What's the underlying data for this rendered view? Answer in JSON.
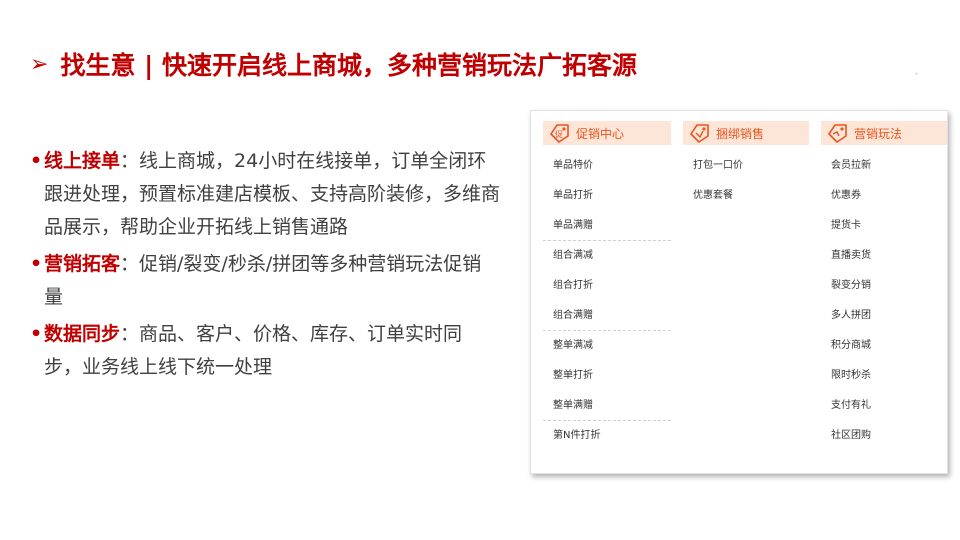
{
  "title": {
    "arrow": "➢",
    "text": "找生意 | 快速开启线上商城，多种营销玩法广拓客源"
  },
  "bullets": [
    {
      "dot": "•",
      "label": "线上接单",
      "separator": "：",
      "text": "线上商城，24小时在线接单，订单全闭环跟进处理，预置标准建店模板、支持高阶装修，多维商品展示，帮助企业开拓线上销售通路"
    },
    {
      "dot": "•",
      "label": "营销拓客",
      "separator": "：",
      "text": "促销/裂变/秒杀/拼团等多种营销玩法促销量"
    },
    {
      "dot": "•",
      "label": "数据同步",
      "separator": "：",
      "text": "商品、客户、价格、库存、订单实时同步，业务线上线下统一处理"
    }
  ],
  "panel": {
    "columns": [
      {
        "header": "促销中心",
        "icon": "promo-tag-icon",
        "items": [
          "单品特价",
          "单品打折",
          "单品满赠",
          "组合满减",
          "组合打折",
          "组合满赠",
          "整单满减",
          "整单打折",
          "整单满赠",
          "第N件打折"
        ]
      },
      {
        "header": "捆绑销售",
        "icon": "bundle-tag-icon",
        "items": [
          "打包一口价",
          "优惠套餐"
        ]
      },
      {
        "header": "营销玩法",
        "icon": "marketing-tag-icon",
        "items": [
          "会员拉新",
          "优惠券",
          "提货卡",
          "直播卖货",
          "裂变分销",
          "多人拼团",
          "积分商城",
          "限时秒杀",
          "支付有礼",
          "社区团购"
        ]
      }
    ]
  },
  "colors": {
    "title_red": "#c00000",
    "accent_orange": "#e8551f",
    "header_bg": "#fde6d8",
    "body_text": "#404040"
  }
}
